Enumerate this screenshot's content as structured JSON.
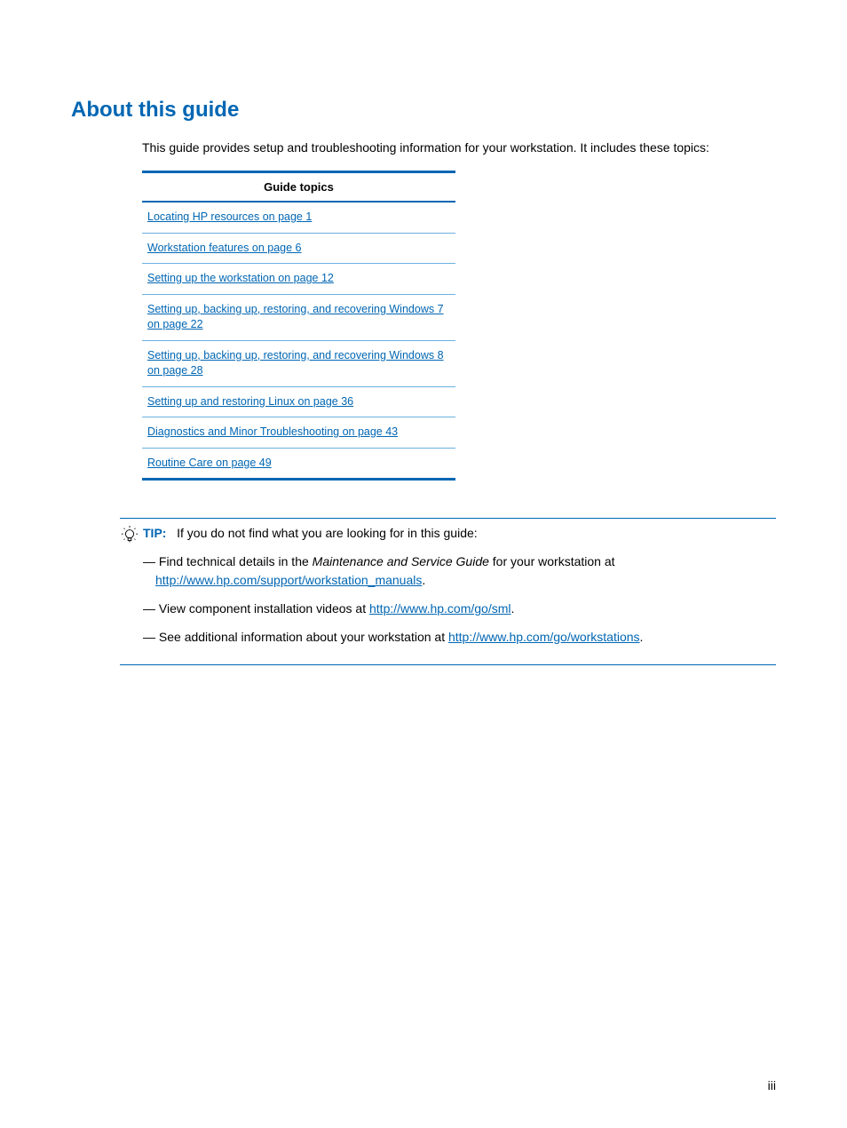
{
  "heading": "About this guide",
  "intro": "This guide provides setup and troubleshooting information for your workstation. It includes these topics:",
  "table": {
    "header": "Guide topics",
    "rows": [
      "Locating HP resources on page 1",
      "Workstation features on page 6",
      "Setting up the workstation on page 12",
      "Setting up, backing up, restoring, and recovering Windows 7 on page 22",
      "Setting up, backing up, restoring, and recovering Windows 8 on page 28",
      "Setting up and restoring Linux on page 36",
      "Diagnostics and Minor Troubleshooting on page 43",
      "Routine Care on page 49"
    ]
  },
  "tip": {
    "label": "TIP:",
    "intro": "If you do not find what you are looking for in this guide:",
    "line1_pre": "— Find technical details in the ",
    "line1_italic": "Maintenance and Service Guide",
    "line1_mid": " for your workstation at ",
    "line1_link": "http://www.hp.com/support/workstation_manuals",
    "line1_post": ".",
    "line2_pre": "— View component installation videos at ",
    "line2_link": "http://www.hp.com/go/sml",
    "line2_post": ".",
    "line3_pre": "— See additional information about your workstation at ",
    "line3_link": "http://www.hp.com/go/workstations",
    "line3_post": "."
  },
  "page_number": "iii"
}
